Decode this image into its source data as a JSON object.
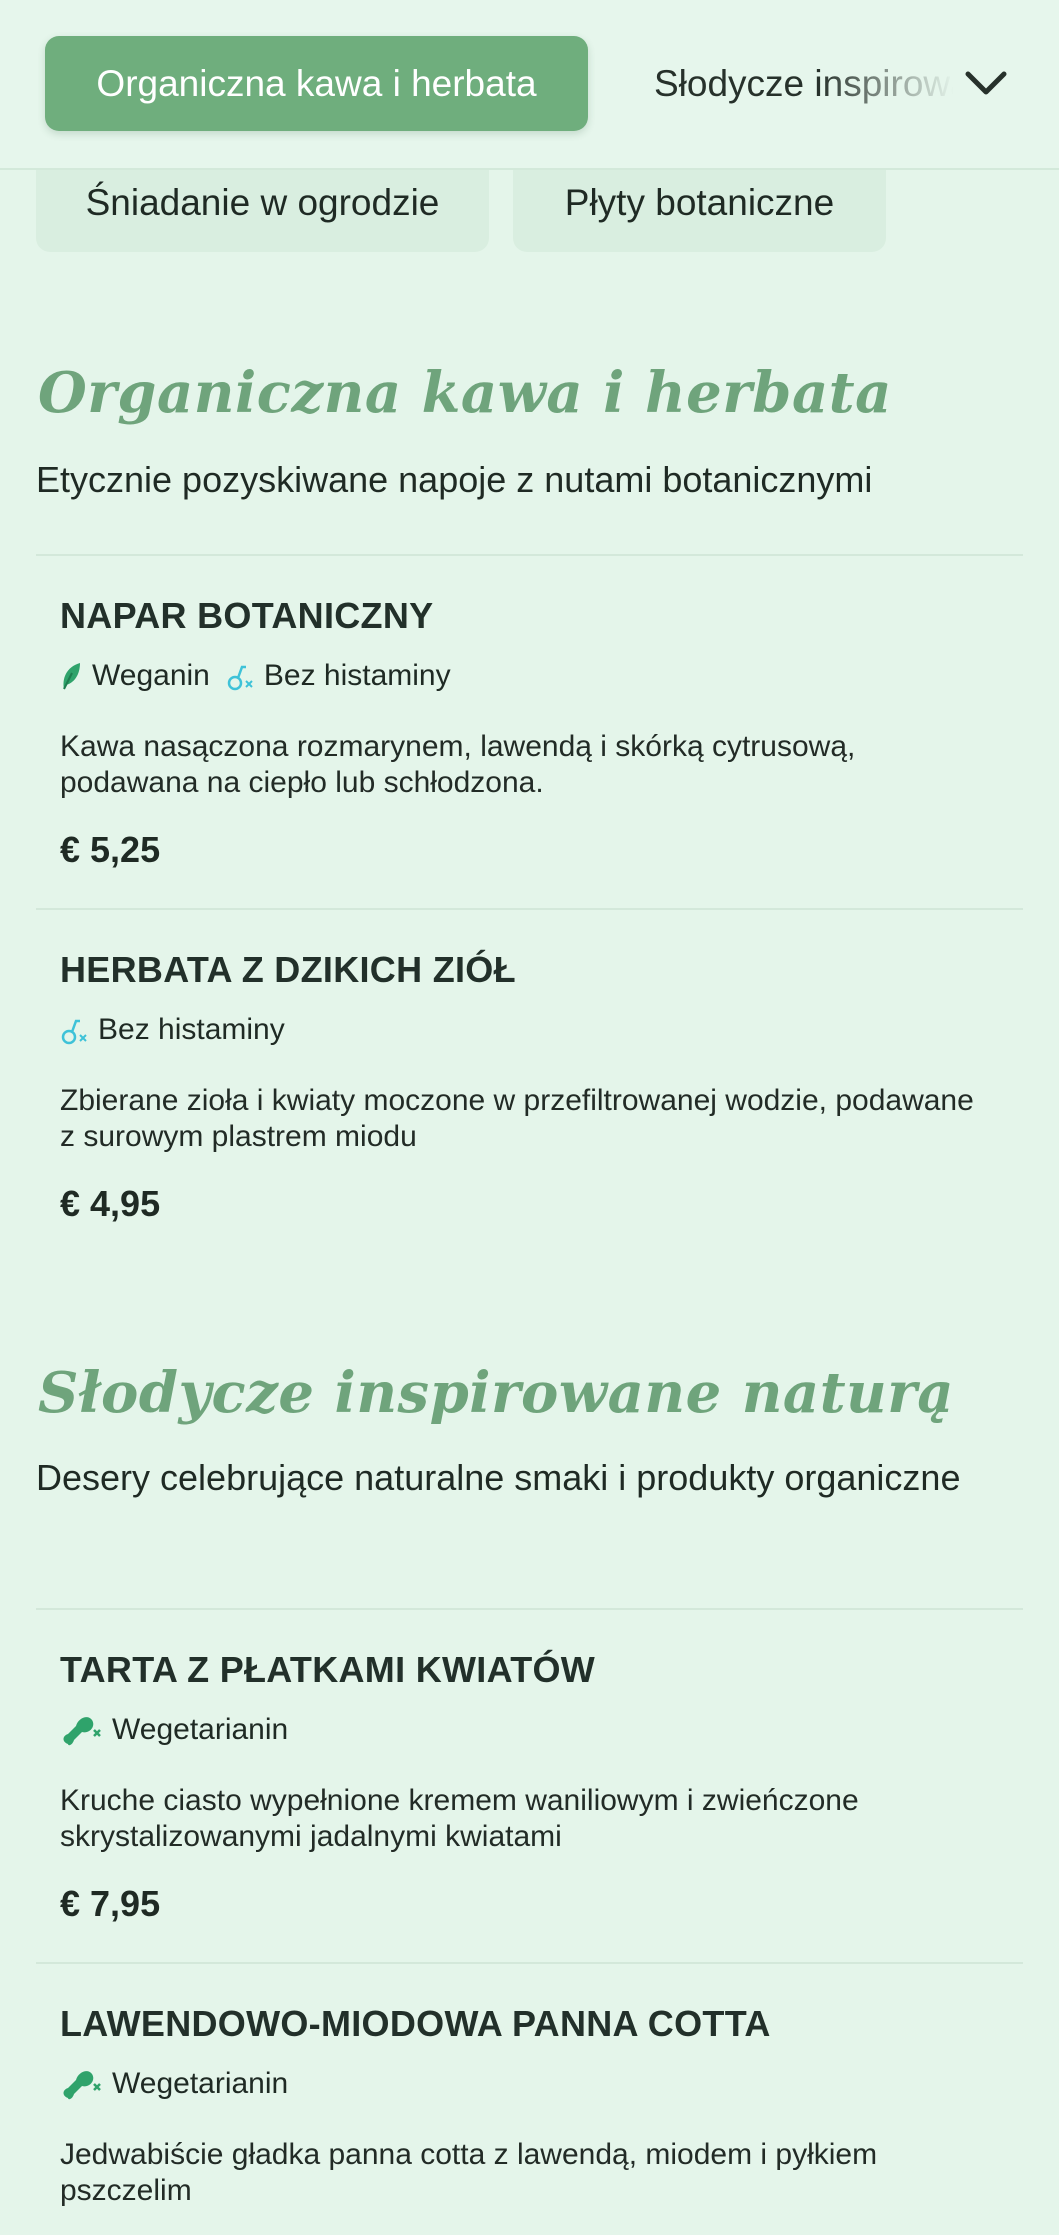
{
  "nav": {
    "active_tab": "Organiczna kawa i herbata",
    "next_tab": "Słodycze inspirowane naturą",
    "chips": [
      "Śniadanie w ogrodzie",
      "Płyty botaniczne"
    ]
  },
  "sections": [
    {
      "title": "Organiczna kawa i herbata",
      "description": "Etycznie pozyskiwane napoje z nutami botanicznymi",
      "items": [
        {
          "name": "NAPAR BOTANICZNY",
          "tags": [
            {
              "label": "Weganin",
              "icon": "leaf-icon"
            },
            {
              "label": "Bez histaminy",
              "icon": "no-histamine-icon"
            }
          ],
          "description": "Kawa nasączona rozmarynem, lawendą i skórką cytrusową, podawana na ciepło lub schłodzona.",
          "price": "€ 5,25"
        },
        {
          "name": "HERBATA Z DZIKICH ZIÓŁ",
          "tags": [
            {
              "label": "Bez histaminy",
              "icon": "no-histamine-icon"
            }
          ],
          "description": "Zbierane zioła i kwiaty moczone w przefiltrowanej wodzie, podawane z surowym plastrem miodu",
          "price": "€ 4,95"
        }
      ]
    },
    {
      "title": "Słodycze inspirowane naturą",
      "description": "Desery celebrujące naturalne smaki i produkty organiczne",
      "items": [
        {
          "name": "TARTA Z PŁATKAMI KWIATÓW",
          "tags": [
            {
              "label": "Wegetarianin",
              "icon": "no-meat-icon"
            }
          ],
          "description": "Kruche ciasto wypełnione kremem waniliowym i zwieńczone skrystalizowanymi jadalnymi kwiatami",
          "price": "€ 7,95"
        },
        {
          "name": "LAWENDOWO-MIODOWA PANNA COTTA",
          "tags": [
            {
              "label": "Wegetarianin",
              "icon": "no-meat-icon"
            }
          ],
          "description": "Jedwabiście gładka panna cotta z lawendą, miodem i pyłkiem pszczelim"
        }
      ]
    }
  ],
  "colors": {
    "background": "#e4f5ea",
    "accent": "#6fae7d",
    "title_green": "#6fa47c",
    "vegan_green": "#2fa36b",
    "histamine_blue": "#3ec2d8"
  }
}
